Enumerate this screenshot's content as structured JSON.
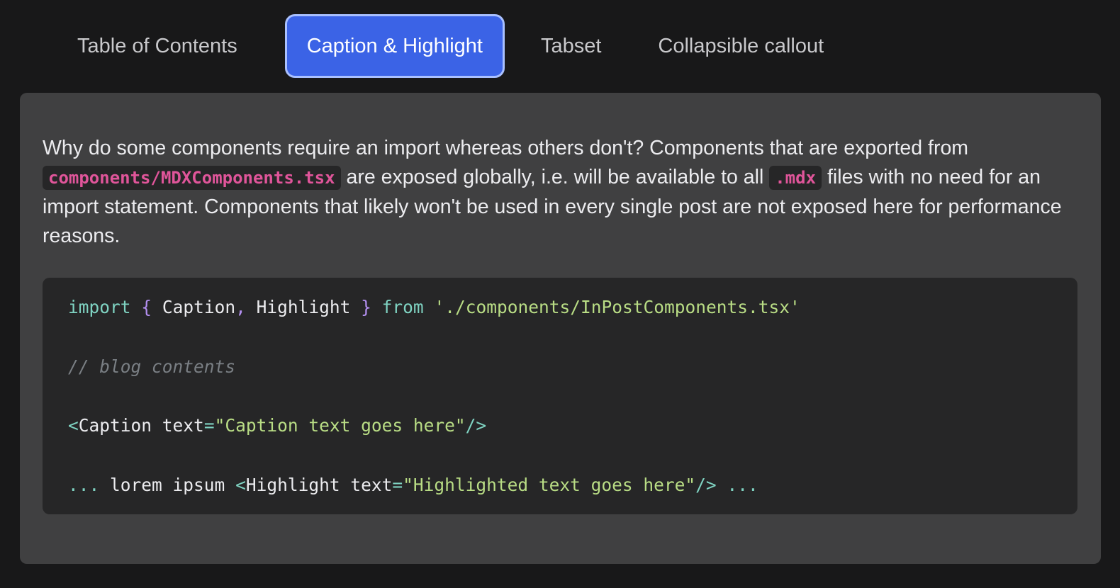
{
  "tabs": [
    {
      "label": "Table of Contents",
      "active": false
    },
    {
      "label": "Caption & Highlight",
      "active": true
    },
    {
      "label": "Tabset",
      "active": false
    },
    {
      "label": "Collapsible callout",
      "active": false
    }
  ],
  "prose": {
    "part1": "Why do some components require an import whereas others don't? Components that are exported from ",
    "code1": "components/MDXComponents.tsx",
    "part2": " are exposed globally, i.e. will be available to all ",
    "code2": ".mdx",
    "part3": " files with no need for an import statement. Components that likely won't be used in every single post are not exposed here for performance reasons."
  },
  "code": {
    "line1": {
      "kw_import": "import",
      "brace_open": "{",
      "name1": "Caption",
      "comma": ",",
      "name2": "Highlight",
      "brace_close": "}",
      "kw_from": "from",
      "path": "'./components/InPostComponents.tsx'"
    },
    "line2": {
      "comment": "// blog contents"
    },
    "line3": {
      "tag_open": "<",
      "component": "Caption",
      "attr": "text",
      "eq": "=",
      "value": "\"Caption text goes here\"",
      "tag_close": "/>"
    },
    "line4": {
      "ellipsis_start": "...",
      "text": "lorem ipsum",
      "tag_open": "<",
      "component": "Highlight",
      "attr": "text",
      "eq": "=",
      "value": "\"Highlighted text goes here\"",
      "tag_close": "/>",
      "ellipsis_end": "..."
    }
  },
  "colors": {
    "background": "#181819",
    "panel": "#404041",
    "active_tab": "#3b63e6",
    "active_tab_border": "#a9c0ff",
    "inline_code_text": "#e0559a",
    "code_bg": "#262627"
  }
}
